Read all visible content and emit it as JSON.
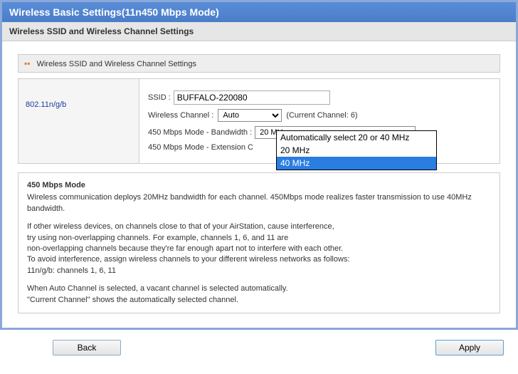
{
  "title": "Wireless Basic Settings(11n450 Mbps Mode)",
  "subtitle": "Wireless SSID and Wireless Channel Settings",
  "section_header": "Wireless SSID and Wireless Channel Settings",
  "standard": "802.11n/g/b",
  "ssid_label": "SSID :",
  "ssid_value": "BUFFALO-220080",
  "channel_label": "Wireless Channel :",
  "channel_value": "Auto",
  "current_channel_text": "(Current Channel: 6)",
  "bandwidth_label": "450 Mbps Mode - Bandwidth :",
  "bandwidth_value": "20 MHz",
  "extension_label": "450 Mbps Mode - Extension C",
  "dropdown": {
    "opt1": "Automatically select 20 or 40 MHz",
    "opt2": "20 MHz",
    "opt3": "40 MHz"
  },
  "help": {
    "heading": "450 Mbps Mode",
    "p1": "Wireless communication deploys 20MHz bandwidth for each channel. 450Mbps mode realizes faster transmission to use 40MHz bandwidth.",
    "p2": "If other wireless devices, on channels close to that of your AirStation, cause interference,",
    "p3": "try using non-overlapping channels. For example, channels 1, 6, and 11 are",
    "p4": "non-overlapping channels because they're far enough apart not to interfere with each other.",
    "p5": "To avoid interference, assign wireless channels to your different wireless networks as follows:",
    "p6": "11n/g/b: channels 1, 6, 11",
    "p7": "When Auto Channel is selected, a vacant channel is selected automatically.",
    "p8": "\"Current Channel\" shows the automatically selected channel."
  },
  "buttons": {
    "back": "Back",
    "apply": "Apply"
  }
}
